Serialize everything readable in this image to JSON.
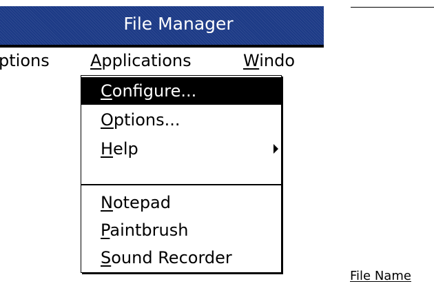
{
  "window": {
    "title": "File Manager"
  },
  "menubar": {
    "items": [
      {
        "pre": "",
        "mnemonic": "",
        "post": "ptions"
      },
      {
        "pre": "",
        "mnemonic": "A",
        "post": "pplications"
      },
      {
        "pre": "",
        "mnemonic": "W",
        "post": "indo"
      }
    ]
  },
  "menu": {
    "items": [
      {
        "mnemonic": "C",
        "post": "onfigure..."
      },
      {
        "mnemonic": "O",
        "post": "ptions..."
      },
      {
        "mnemonic": "H",
        "post": "elp"
      },
      {
        "mnemonic": "N",
        "post": "otepad"
      },
      {
        "mnemonic": "P",
        "post": "aintbrush"
      },
      {
        "mnemonic": "S",
        "post": "ound Recorder"
      }
    ]
  },
  "column": {
    "header": "File Name"
  },
  "colors": {
    "titlebar": "#1c3a86",
    "selection": "#000000",
    "title_text": "#ffffff"
  },
  "icons": {
    "submenu": "chevron-right-icon"
  }
}
